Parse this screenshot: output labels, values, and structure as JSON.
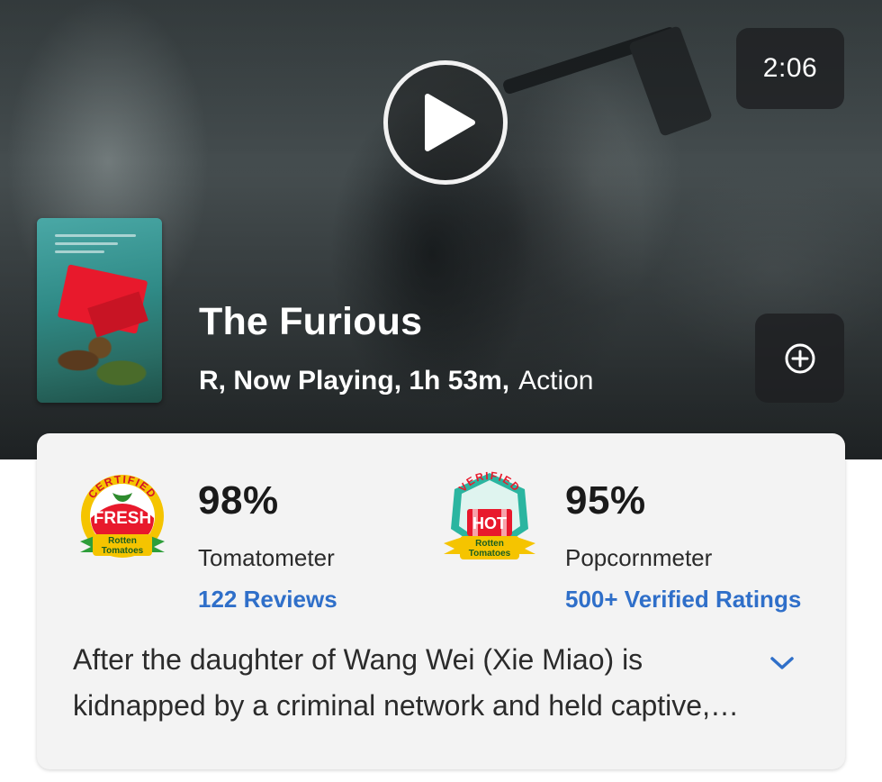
{
  "hero": {
    "duration": "2:06",
    "title": "The Furious",
    "meta": "R, Now Playing, 1h 53m,",
    "genre": "Action",
    "icons": {
      "play": "play-icon",
      "add": "plus-circle-icon"
    }
  },
  "scores": {
    "tomatometer": {
      "value": "98%",
      "label": "Tomatometer",
      "reviews": "122 Reviews",
      "badge": {
        "top": "CERTIFIED",
        "main": "FRESH",
        "brand_line1": "Rotten",
        "brand_line2": "Tomatoes"
      }
    },
    "popcornmeter": {
      "value": "95%",
      "label": "Popcornmeter",
      "reviews": "500+ Verified Ratings",
      "badge": {
        "top": "VERIFIED",
        "main": "HOT",
        "brand_line1": "Rotten",
        "brand_line2": "Tomatoes"
      }
    }
  },
  "synopsis": "After the daughter of Wang Wei (Xie Miao) is kidnapped by a criminal network and held captive, he teams up with a journalist to track down those responsible.",
  "colors": {
    "link": "#2f6fc9",
    "fresh_red": "#e8192c",
    "tomato_yellow": "#f5c400",
    "hot_teal": "#2bb5a0",
    "card_bg": "#f3f3f3"
  }
}
